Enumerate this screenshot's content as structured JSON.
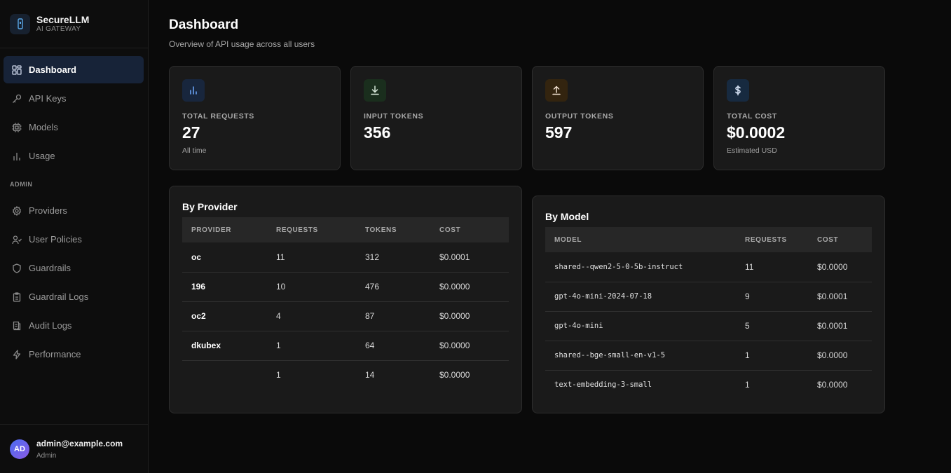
{
  "brand": {
    "name": "SecureLLM",
    "subtitle": "AI GATEWAY"
  },
  "nav": {
    "items": [
      {
        "label": "Dashboard",
        "icon": "dashboard-icon",
        "active": true
      },
      {
        "label": "API Keys",
        "icon": "key-icon"
      },
      {
        "label": "Models",
        "icon": "cpu-icon"
      },
      {
        "label": "Usage",
        "icon": "bar-chart-icon"
      }
    ],
    "admin_section": "ADMIN",
    "admin_items": [
      {
        "label": "Providers",
        "icon": "gear-icon"
      },
      {
        "label": "User Policies",
        "icon": "users-icon"
      },
      {
        "label": "Guardrails",
        "icon": "shield-icon"
      },
      {
        "label": "Guardrail Logs",
        "icon": "clipboard-icon"
      },
      {
        "label": "Audit Logs",
        "icon": "receipt-icon"
      },
      {
        "label": "Performance",
        "icon": "lightning-icon"
      }
    ]
  },
  "user": {
    "initials": "AD",
    "email": "admin@example.com",
    "role": "Admin"
  },
  "page": {
    "title": "Dashboard",
    "subtitle": "Overview of API usage across all users"
  },
  "stats": [
    {
      "label": "TOTAL REQUESTS",
      "value": "27",
      "note": "All time",
      "icon": "bar-chart-icon",
      "color": "#6ea8ff"
    },
    {
      "label": "INPUT TOKENS",
      "value": "356",
      "note": "",
      "icon": "download-icon",
      "color": "#7fd18b"
    },
    {
      "label": "OUTPUT TOKENS",
      "value": "597",
      "note": "",
      "icon": "upload-icon",
      "color": "#f0b070"
    },
    {
      "label": "TOTAL COST",
      "value": "$0.0002",
      "note": "Estimated USD",
      "icon": "dollar-icon",
      "color": "#8fc4ff"
    }
  ],
  "by_provider": {
    "title": "By Provider",
    "columns": [
      "PROVIDER",
      "REQUESTS",
      "TOKENS",
      "COST"
    ],
    "rows": [
      [
        "oc",
        "11",
        "312",
        "$0.0001"
      ],
      [
        "196",
        "10",
        "476",
        "$0.0000"
      ],
      [
        "oc2",
        "4",
        "87",
        "$0.0000"
      ],
      [
        "dkubex",
        "1",
        "64",
        "$0.0000"
      ],
      [
        "",
        "1",
        "14",
        "$0.0000"
      ]
    ]
  },
  "by_model": {
    "title": "By Model",
    "columns": [
      "MODEL",
      "REQUESTS",
      "COST"
    ],
    "rows": [
      [
        "shared--qwen2-5-0-5b-instruct",
        "11",
        "$0.0000"
      ],
      [
        "gpt-4o-mini-2024-07-18",
        "9",
        "$0.0001"
      ],
      [
        "gpt-4o-mini",
        "5",
        "$0.0001"
      ],
      [
        "shared--bge-small-en-v1-5",
        "1",
        "$0.0000"
      ],
      [
        "text-embedding-3-small",
        "1",
        "$0.0000"
      ]
    ]
  }
}
